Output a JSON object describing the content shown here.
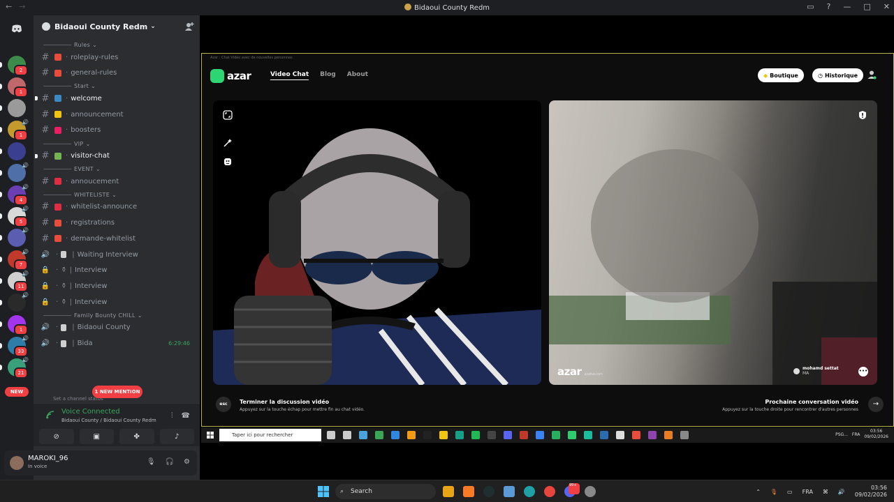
{
  "window": {
    "title": "Bidaoui County Redm"
  },
  "server": {
    "name": "Bidaoui County Redm"
  },
  "guild_badges": [
    "2",
    "1",
    "",
    "1",
    "",
    "",
    "4",
    "5",
    "",
    "7",
    "11",
    "",
    "1",
    "33",
    "21"
  ],
  "new_badge": "NEW",
  "channels": [
    {
      "type": "cat",
      "label": "Rules"
    },
    {
      "type": "text",
      "label": "roleplay-rules",
      "bright": false
    },
    {
      "type": "text",
      "label": "general-rules",
      "bright": false
    },
    {
      "type": "cat",
      "label": "Start"
    },
    {
      "type": "text",
      "label": "welcome",
      "bright": true
    },
    {
      "type": "text",
      "label": "announcement",
      "bright": false
    },
    {
      "type": "text",
      "label": "boosters",
      "bright": false
    },
    {
      "type": "cat",
      "label": "VIP"
    },
    {
      "type": "text",
      "label": "visitor-chat",
      "bright": true
    },
    {
      "type": "cat",
      "label": "EVENT"
    },
    {
      "type": "text",
      "label": "annoucement",
      "bright": false
    },
    {
      "type": "cat",
      "label": "WHITELISTE"
    },
    {
      "type": "text",
      "label": "whitelist-announce",
      "bright": false
    },
    {
      "type": "text",
      "label": "registrations",
      "bright": false
    },
    {
      "type": "text",
      "label": "demande-whitelist",
      "bright": false
    },
    {
      "type": "voice",
      "label": "Waiting Interview"
    },
    {
      "type": "locked",
      "label": "Interview"
    },
    {
      "type": "locked",
      "label": "Interview"
    },
    {
      "type": "locked",
      "label": "Interview"
    },
    {
      "type": "cat",
      "label": "Family Bounty CHILL"
    },
    {
      "type": "voice",
      "label": "Bidaoui County"
    },
    {
      "type": "voice",
      "label": "Bida"
    }
  ],
  "voice_timer": "6:29:46",
  "mention_badge": "1 NEW MENTION",
  "channel_status_note": "Set a channel status",
  "voice": {
    "status": "Voice Connected",
    "location": "Bidaoui County / Bidaoui County Redm"
  },
  "user": {
    "name": "MAROKI_96",
    "status": "In voice"
  },
  "azar": {
    "window_title": "Azar : Chat Vidéo avec de nouvelles personnes",
    "logo": "azar",
    "nav": [
      "Video Chat",
      "Blog",
      "About"
    ],
    "boutique": "Boutique",
    "historique": "Historique",
    "watermark": "azar",
    "watermark_sub": "azarlive.com",
    "partner_name": "mohamd settat",
    "partner_country": "MA",
    "end_title": "Terminer la discussion vidéo",
    "end_sub": "Appuyez sur la touche échap pour mettre fin au chat vidéo.",
    "esc": "esc",
    "next_title": "Prochaine conversation vidéo",
    "next_sub": "Appuyez sur la touche droite pour rencontrer d'autres personnes"
  },
  "inner_taskbar": {
    "search_placeholder": "Taper ici pour rechercher",
    "lang": "FRA",
    "time": "03:56",
    "date": "09/02/2026",
    "psg": "PSG..."
  },
  "taskbar": {
    "search": "Search",
    "lang": "FRA",
    "time": "03:56",
    "date": "09/02/2026",
    "notif_count": "99+"
  },
  "colors": {
    "discord_bg": "#2b2d31",
    "green": "#3ba55d",
    "red": "#f23f43",
    "azar_green": "#2ed573"
  }
}
